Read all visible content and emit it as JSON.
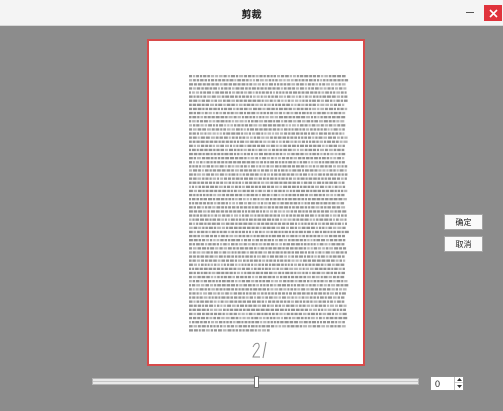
{
  "window": {
    "title": "剪裁",
    "minimize_icon": "minimize-icon",
    "close_icon": "close-icon",
    "close_color": "#e0333c"
  },
  "document": {
    "border_color": "#d84a4a",
    "page_number": "2/"
  },
  "buttons": {
    "confirm_label": "确定",
    "cancel_label": "取消"
  },
  "zoom_slider": {
    "value_fraction": 0.5
  },
  "spinbox": {
    "value": "0"
  }
}
